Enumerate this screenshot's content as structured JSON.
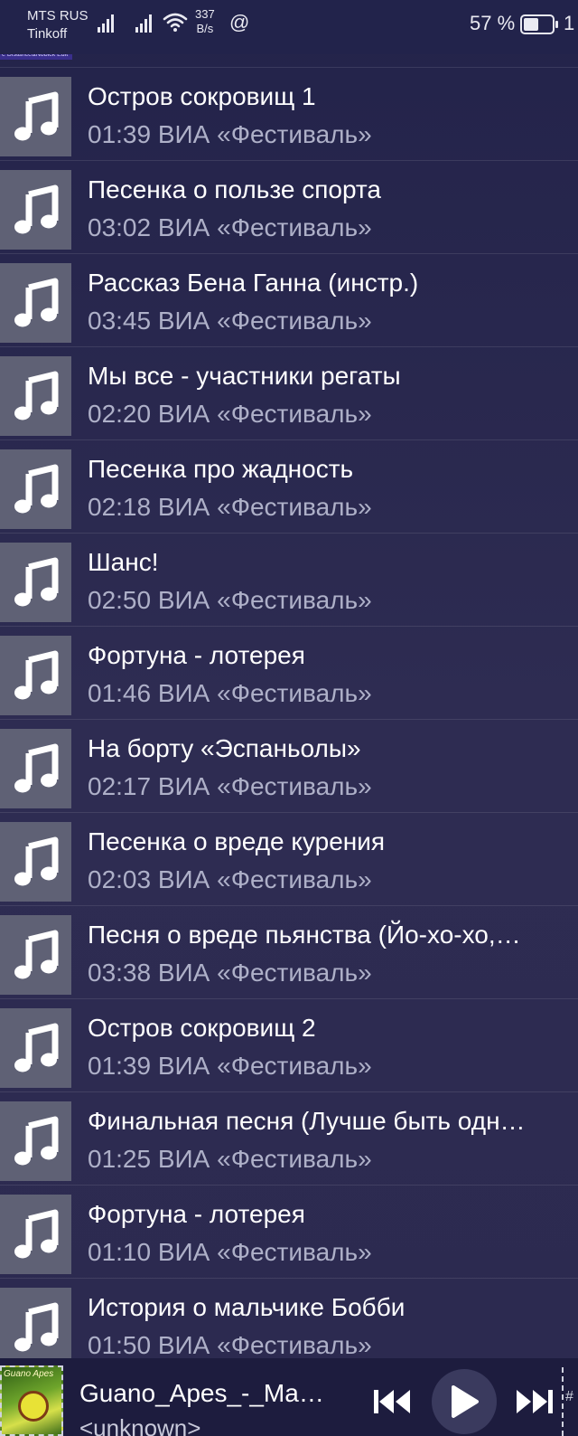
{
  "status_bar": {
    "carrier_line1": "MTS RUS",
    "carrier_line2": "Tinkoff",
    "net_speed_value": "337",
    "net_speed_unit": "B/s",
    "at_symbol": "@",
    "battery_percent": "57 %",
    "clock_fragment": "1"
  },
  "header_strip_text": "e Distance&Noblck Edit",
  "tracks": [
    {
      "title": "Остров сокровищ 1",
      "duration": "01:39",
      "artist": "ВИА «Фестиваль»"
    },
    {
      "title": "Песенка о пользе спорта",
      "duration": "03:02",
      "artist": "ВИА «Фестиваль»"
    },
    {
      "title": "Рассказ Бена Ганна (инстр.)",
      "duration": "03:45",
      "artist": "ВИА «Фестиваль»"
    },
    {
      "title": "Мы все - участники регаты",
      "duration": "02:20",
      "artist": "ВИА «Фестиваль»"
    },
    {
      "title": "Песенка про жадность",
      "duration": "02:18",
      "artist": "ВИА «Фестиваль»"
    },
    {
      "title": "Шанс!",
      "duration": "02:50",
      "artist": "ВИА «Фестиваль»"
    },
    {
      "title": "Фортуна - лотерея",
      "duration": "01:46",
      "artist": "ВИА «Фестиваль»"
    },
    {
      "title": "На борту «Эспаньолы»",
      "duration": "02:17",
      "artist": "ВИА «Фестиваль»"
    },
    {
      "title": "Песенка о вреде курения",
      "duration": "02:03",
      "artist": "ВИА «Фестиваль»"
    },
    {
      "title": "Песня о вреде пьянства (Йо-хо-хо,…",
      "duration": "03:38",
      "artist": "ВИА «Фестиваль»"
    },
    {
      "title": "Остров сокровищ 2",
      "duration": "01:39",
      "artist": "ВИА «Фестиваль»"
    },
    {
      "title": "Финальная песня (Лучше быть одн…",
      "duration": "01:25",
      "artist": "ВИА «Фестиваль»"
    },
    {
      "title": "Фортуна - лотерея",
      "duration": "01:10",
      "artist": "ВИА «Фестиваль»"
    },
    {
      "title": "История о мальчике Бобби",
      "duration": "01:50",
      "artist": "ВИА «Фестиваль»"
    }
  ],
  "player": {
    "album_art_text": "Guano Apes",
    "now_playing_title": "Guano_Apes_-_Ma…",
    "now_playing_artist": "<unknown>",
    "queue_label": "#",
    "icons": {
      "prev": "skip-previous-icon",
      "play": "play-icon",
      "next": "skip-next-icon"
    }
  },
  "colors": {
    "background": "#2b2a4e",
    "thumb": "#5f6175",
    "secondary_text": "#aeb0c8",
    "player_bar": "#1d1c3e"
  }
}
